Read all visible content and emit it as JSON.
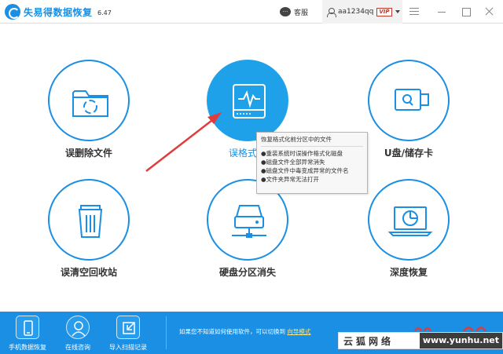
{
  "header": {
    "app_title": "失易得数据恢复",
    "version": "6.47",
    "service_label": "客服",
    "username": "aa1234qq",
    "vip_badge": "VIP"
  },
  "features": [
    {
      "label": "误删除文件",
      "icon": "folder-recycle-icon"
    },
    {
      "label": "误格式化",
      "icon": "hard-drive-pulse-icon",
      "active": true
    },
    {
      "label": "U盘/储存卡",
      "icon": "usb-drive-icon"
    },
    {
      "label": "误清空回收站",
      "icon": "trash-bin-icon"
    },
    {
      "label": "硬盘分区消失",
      "icon": "network-drive-icon"
    },
    {
      "label": "深度恢复",
      "icon": "laptop-disk-icon"
    }
  ],
  "tooltip": {
    "title": "恢复格式化前分区中的文件",
    "items": [
      "●重装系统时误操作格式化磁盘",
      "●磁盘文件全部异常消失",
      "●磁盘文件中毒变成异常的文件名",
      "●文件夹异常无法打开"
    ]
  },
  "bottom": {
    "buttons": [
      {
        "label": "手机数据恢复",
        "icon": "phone-icon"
      },
      {
        "label": "在线咨询",
        "icon": "consultant-icon"
      },
      {
        "label": "导入扫描记录",
        "icon": "import-icon"
      }
    ],
    "hint_text": "如果您不知道如何使用软件，可以切换到",
    "hint_link": "向导模式"
  },
  "watermark": {
    "left_text": "云狐网络",
    "right_text": "www.yunhu.net"
  },
  "colors": {
    "accent": "#1a8fe3",
    "active_circle": "#1fa1ea",
    "arrow": "#e03c3c",
    "vip": "#c0392b"
  }
}
